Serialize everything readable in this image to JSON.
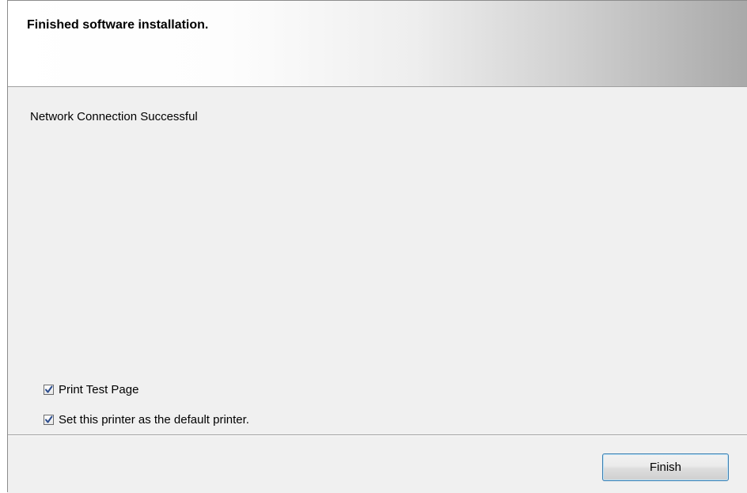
{
  "header": {
    "title": "Finished software installation."
  },
  "content": {
    "status_text": "Network Connection Successful",
    "options": [
      {
        "label": "Print Test Page",
        "checked": true
      },
      {
        "label": "Set this printer as the default printer.",
        "checked": true
      }
    ]
  },
  "footer": {
    "finish_label": "Finish"
  },
  "colors": {
    "check_mark": "#2a4b8d",
    "button_border": "#3c7fb1",
    "dialog_background": "#f0f0f0"
  },
  "icons": {
    "checkbox": "checkmark-icon"
  }
}
